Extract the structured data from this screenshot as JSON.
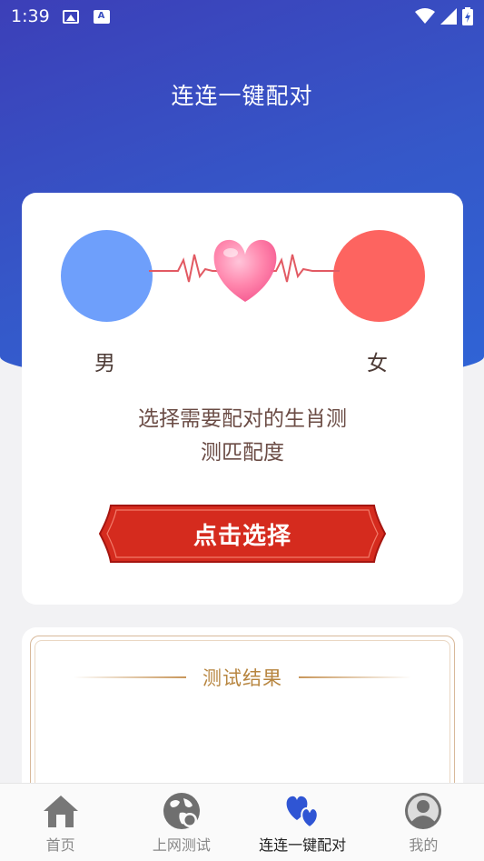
{
  "status_bar": {
    "time": "1:39"
  },
  "header": {
    "title": "连连一键配对"
  },
  "pair_card": {
    "male_label": "男",
    "female_label": "女",
    "description_line1": "选择需要配对的生肖测",
    "description_line2": "测匹配度",
    "select_button_label": "点击选择"
  },
  "result_card": {
    "title": "测试结果"
  },
  "bottom_nav": {
    "items": [
      {
        "label": "首页",
        "icon": "home-icon"
      },
      {
        "label": "上网测试",
        "icon": "globe-icon"
      },
      {
        "label": "连连一键配对",
        "icon": "hearts-icon",
        "active": true
      },
      {
        "label": "我的",
        "icon": "profile-icon"
      }
    ]
  },
  "colors": {
    "header_blue": "#3558c9",
    "male_circle": "#6e9ffb",
    "female_circle": "#fd6460",
    "button_red": "#d82e1f",
    "nav_active_blue": "#2f55d4"
  }
}
